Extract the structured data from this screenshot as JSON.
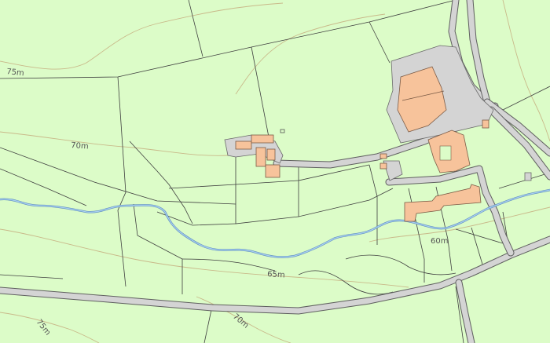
{
  "map": {
    "colors": {
      "land": "#dcfcc8",
      "road": "#d4d4d4",
      "road_edge": "#5f5f5f",
      "building": "#f7c39b",
      "water": "#a8cff0",
      "contour": "#c9b98a",
      "field_boundary": "#3f3f3f"
    },
    "contour_labels": {
      "l75_top": "75m",
      "l70_upper": "70m",
      "l60": "60m",
      "l65": "65m",
      "l75_bottom": "75m",
      "l70_bottom": "70m"
    }
  }
}
